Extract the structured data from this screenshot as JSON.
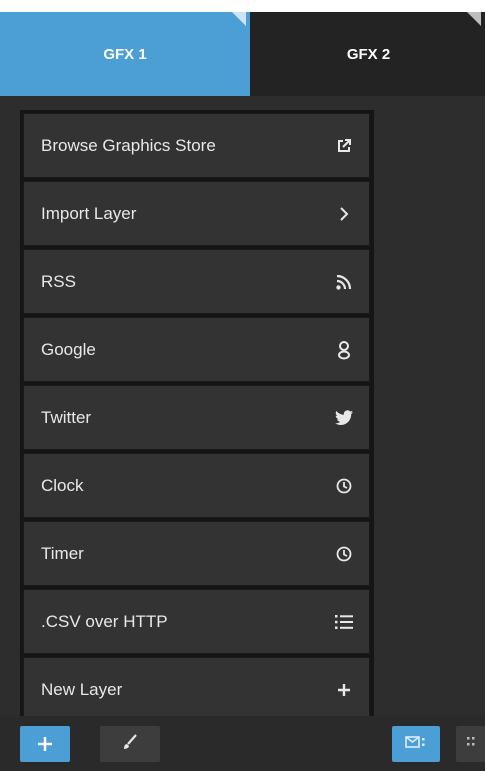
{
  "tabs": [
    {
      "label": "GFX 1",
      "active": true
    },
    {
      "label": "GFX 2",
      "active": false
    }
  ],
  "menu": {
    "items": [
      {
        "label": "Browse Graphics Store",
        "icon": "external-link-icon"
      },
      {
        "label": "Import Layer",
        "icon": "chevron-right-icon"
      },
      {
        "label": "RSS",
        "icon": "rss-icon"
      },
      {
        "label": "Google",
        "icon": "google-icon"
      },
      {
        "label": "Twitter",
        "icon": "twitter-icon"
      },
      {
        "label": "Clock",
        "icon": "clock-icon"
      },
      {
        "label": "Timer",
        "icon": "clock-icon"
      },
      {
        "label": ".CSV over HTTP",
        "icon": "list-icon"
      },
      {
        "label": "New Layer",
        "icon": "plus-icon"
      }
    ]
  },
  "toolbar": {
    "buttons": [
      {
        "name": "add-button",
        "icon": "plus-icon"
      },
      {
        "name": "brush-button",
        "icon": "brush-icon"
      },
      {
        "name": "view-button",
        "icon": "mail-list-icon"
      },
      {
        "name": "grid-view-button",
        "icon": "grid-icon"
      }
    ]
  },
  "colors": {
    "accent": "#4b9fd5",
    "panel": "#2d2d2d",
    "menu_item": "#333333",
    "text": "#e8e8e8"
  }
}
